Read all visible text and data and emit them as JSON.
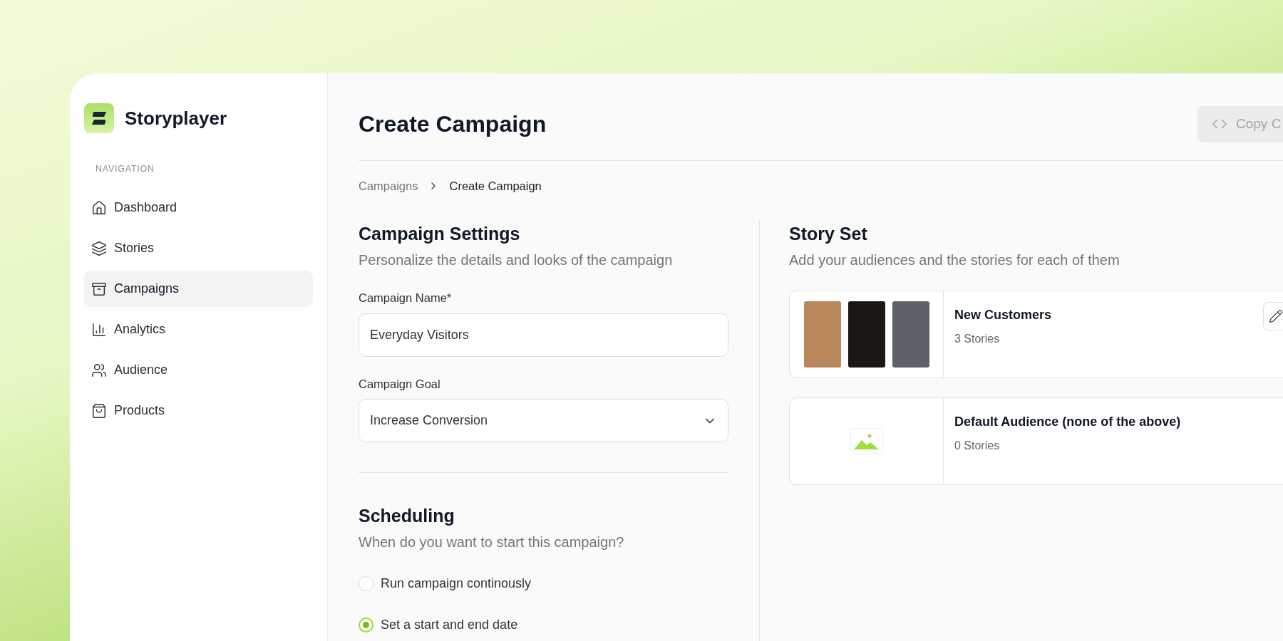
{
  "brand": {
    "name": "Storyplayer"
  },
  "sidebar": {
    "heading": "NAVIGATION",
    "items": [
      {
        "label": "Dashboard",
        "selected": false
      },
      {
        "label": "Stories",
        "selected": false
      },
      {
        "label": "Campaigns",
        "selected": true
      },
      {
        "label": "Analytics",
        "selected": false
      },
      {
        "label": "Audience",
        "selected": false
      },
      {
        "label": "Products",
        "selected": false
      }
    ]
  },
  "header": {
    "title": "Create Campaign",
    "copy_button": {
      "label": "Copy C",
      "disabled": true
    }
  },
  "breadcrumb": [
    "Campaigns",
    "Create Campaign"
  ],
  "settings": {
    "title": "Campaign Settings",
    "subtitle": "Personalize the details and looks of the campaign",
    "fields": [
      {
        "kind": "text",
        "label": "Campaign Name*",
        "value": "Everyday Visitors"
      },
      {
        "kind": "select",
        "label": "Campaign Goal",
        "value": "Increase Conversion"
      }
    ]
  },
  "scheduling": {
    "title": "Scheduling",
    "subtitle": "When do you want to start this campaign?",
    "options": [
      {
        "label": "Run campaign continously",
        "selected": false
      },
      {
        "label": "Set a start and end date",
        "selected": true
      }
    ]
  },
  "story_set": {
    "title": "Story Set",
    "subtitle": "Add your audiences and the stories for each of them",
    "audiences": [
      {
        "kind": "thumbnails",
        "name": "New Customers",
        "count": "3 Stories",
        "edit_button": true
      },
      {
        "kind": "empty",
        "name": "Default Audience (none of the above)",
        "count": "0 Stories",
        "edit_button": false
      }
    ]
  }
}
